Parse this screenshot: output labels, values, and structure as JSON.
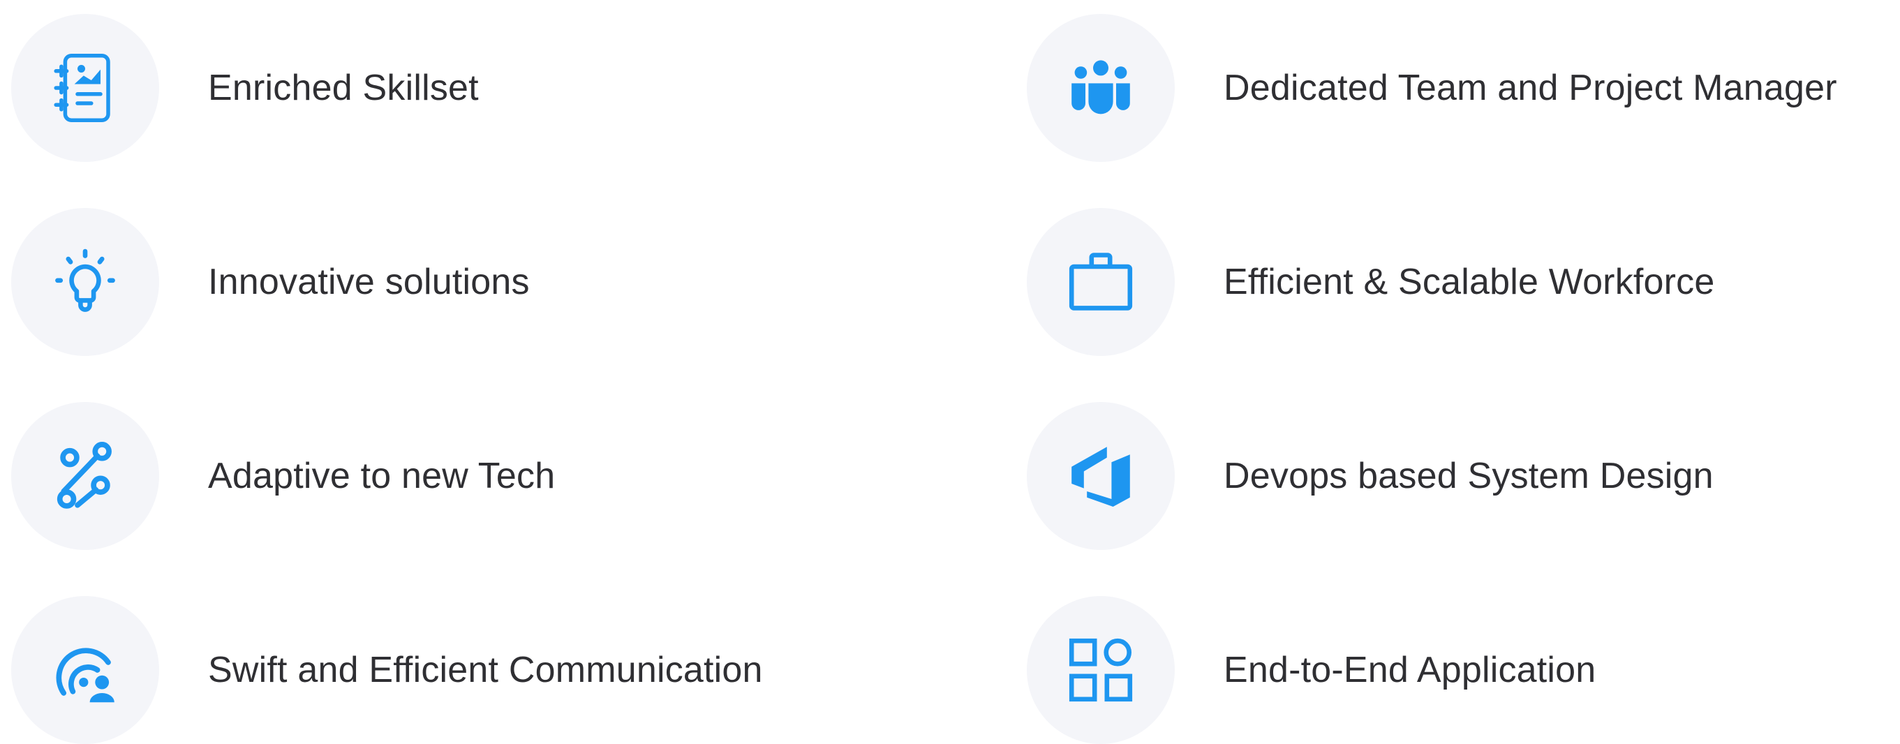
{
  "theme": {
    "accent": "#1e96f0",
    "icon_background": "#f4f5f9",
    "text": "#2f2f33"
  },
  "features": [
    {
      "label": "Enriched Skillset",
      "icon": "report-chart-icon"
    },
    {
      "label": "Innovative solutions",
      "icon": "lightbulb-icon"
    },
    {
      "label": "Adaptive to new Tech",
      "icon": "connected-nodes-icon"
    },
    {
      "label": "Swift and Efficient Communication",
      "icon": "broadcast-user-icon"
    },
    {
      "label": "Dedicated Team and Project Manager",
      "icon": "team-icon"
    },
    {
      "label": "Efficient & Scalable Workforce",
      "icon": "briefcase-icon"
    },
    {
      "label": "Devops based System Design",
      "icon": "azure-devops-icon"
    },
    {
      "label": "End-to-End Application",
      "icon": "apps-grid-icon"
    }
  ]
}
